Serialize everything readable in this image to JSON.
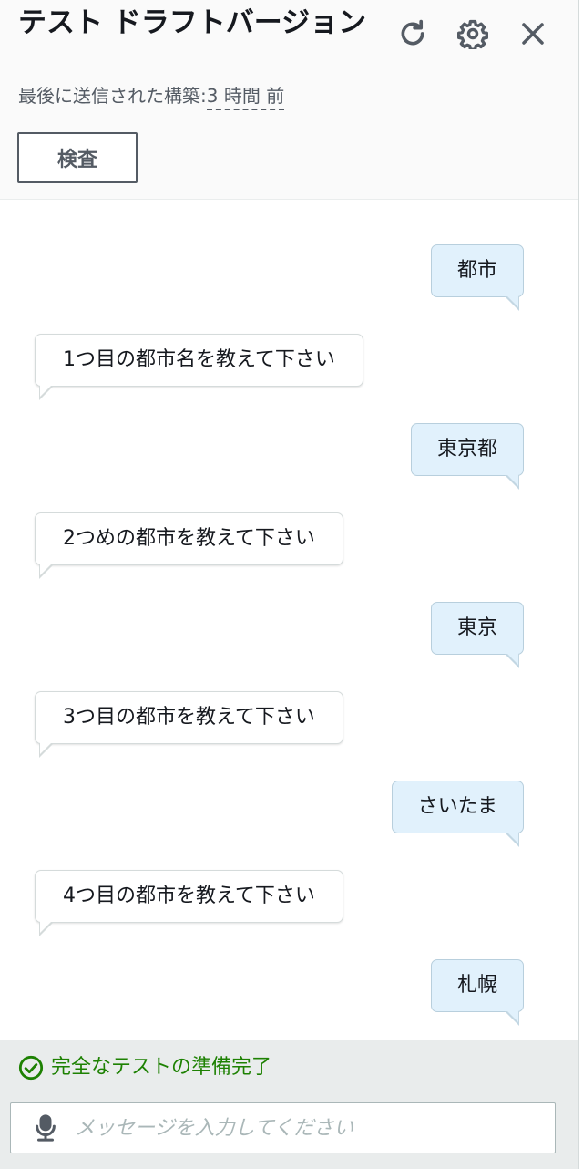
{
  "header": {
    "title": "テスト ドラフトバージョン",
    "subtitle_prefix": "最後に送信された構築:",
    "subtitle_relative": "3 時間 前",
    "inspect_label": "検査",
    "icons": [
      "refresh-icon",
      "gear-icon",
      "close-icon"
    ]
  },
  "messages": [
    {
      "role": "user",
      "text": "都市"
    },
    {
      "role": "bot",
      "text": "1つ目の都市名を教えて下さい"
    },
    {
      "role": "user",
      "text": "東京都"
    },
    {
      "role": "bot",
      "text": "2つめの都市を教えて下さい"
    },
    {
      "role": "user",
      "text": "東京"
    },
    {
      "role": "bot",
      "text": "3つ目の都市を教えて下さい"
    },
    {
      "role": "user",
      "text": "さいたま"
    },
    {
      "role": "bot",
      "text": "4つ目の都市を教えて下さい"
    },
    {
      "role": "user",
      "text": "札幌"
    }
  ],
  "footer": {
    "status_text": "完全なテストの準備完了",
    "status_color": "#1d8102",
    "input_placeholder": "メッセージを入力してください",
    "input_value": ""
  },
  "colors": {
    "user_bubble": "#e1f1fc",
    "bot_bubble": "#ffffff",
    "footer_bg": "#e9ecec"
  }
}
